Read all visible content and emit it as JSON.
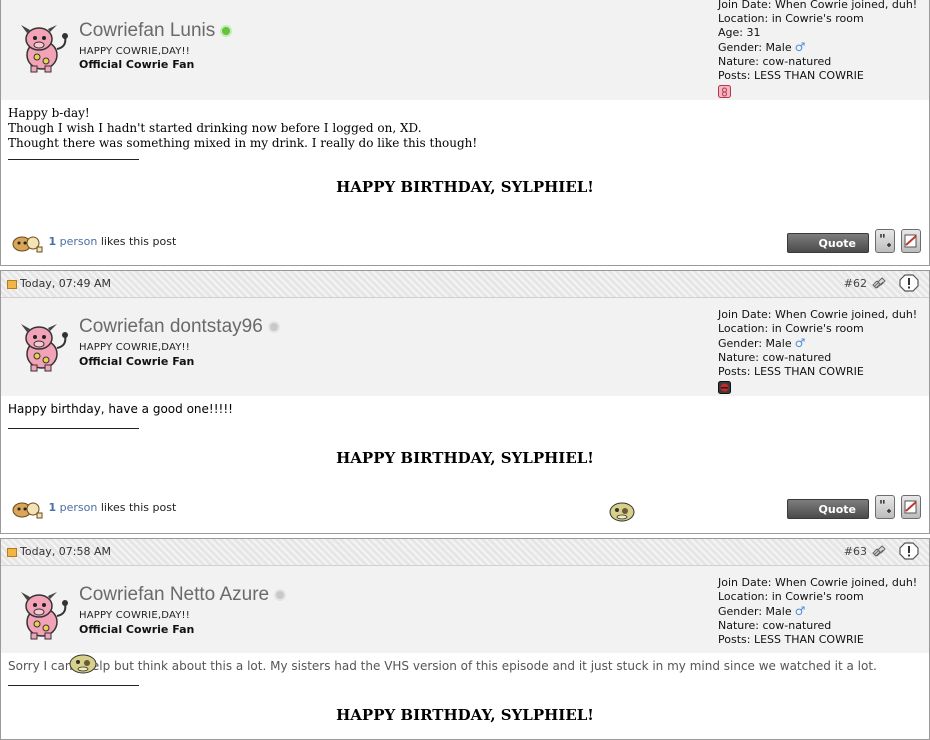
{
  "posts": [
    {
      "user": {
        "name": "Cowriefan Lunis",
        "status": "online",
        "title": "HAPPY COWRIE,DAY!!",
        "rank": "Official Cowrie Fan",
        "join": "Join Date: When Cowrie joined, duh!",
        "location": "Location: in Cowrie's room",
        "age": "Age: 31",
        "gender": "Gender: Male",
        "gender_symbol": "♂",
        "nature": "Nature: cow-natured",
        "posts_count": "Posts: LESS THAN COWRIE"
      },
      "message": [
        "Happy b-day!",
        "Though I wish I hadn't started drinking now before I logged on, XD.",
        "Thought there was something mixed in my drink. I really do like this though!"
      ],
      "signature": "HAPPY BIRTHDAY, SYLPHIEL!",
      "likes_count": "1",
      "likes_person": "person",
      "likes_text": "likes this post",
      "quote_label": "Quote"
    },
    {
      "date": "Today, 07:49 AM",
      "number": "#62",
      "user": {
        "name": "Cowriefan dontstay96",
        "status": "offline",
        "title": "HAPPY COWRIE,DAY!!",
        "rank": "Official Cowrie Fan",
        "join": "Join Date: When Cowrie joined, duh!",
        "location": "Location: in Cowrie's room",
        "gender": "Gender: Male",
        "gender_symbol": "♂",
        "nature": "Nature: cow-natured",
        "posts_count": "Posts: LESS THAN COWRIE"
      },
      "message": [
        "Happy birthday, have a good one!!!!!"
      ],
      "signature": "HAPPY BIRTHDAY, SYLPHIEL!",
      "likes_count": "1",
      "likes_person": "person",
      "likes_text": "likes this post",
      "quote_label": "Quote"
    },
    {
      "date": "Today, 07:58 AM",
      "number": "#63",
      "user": {
        "name": "Cowriefan Netto Azure",
        "status": "offline",
        "title": "HAPPY COWRIE,DAY!!",
        "rank": "Official Cowrie Fan",
        "join": "Join Date: When Cowrie joined, duh!",
        "location": "Location: in Cowrie's room",
        "gender": "Gender: Male",
        "gender_symbol": "♂",
        "nature": "Nature: cow-natured",
        "posts_count": "Posts: LESS THAN COWRIE"
      },
      "message": [
        "Sorry I can't help but think about this a lot. My sisters had the VHS version of this episode and it just stuck in my mind since we watched it a lot."
      ],
      "signature": "HAPPY BIRTHDAY, SYLPHIEL!"
    }
  ]
}
